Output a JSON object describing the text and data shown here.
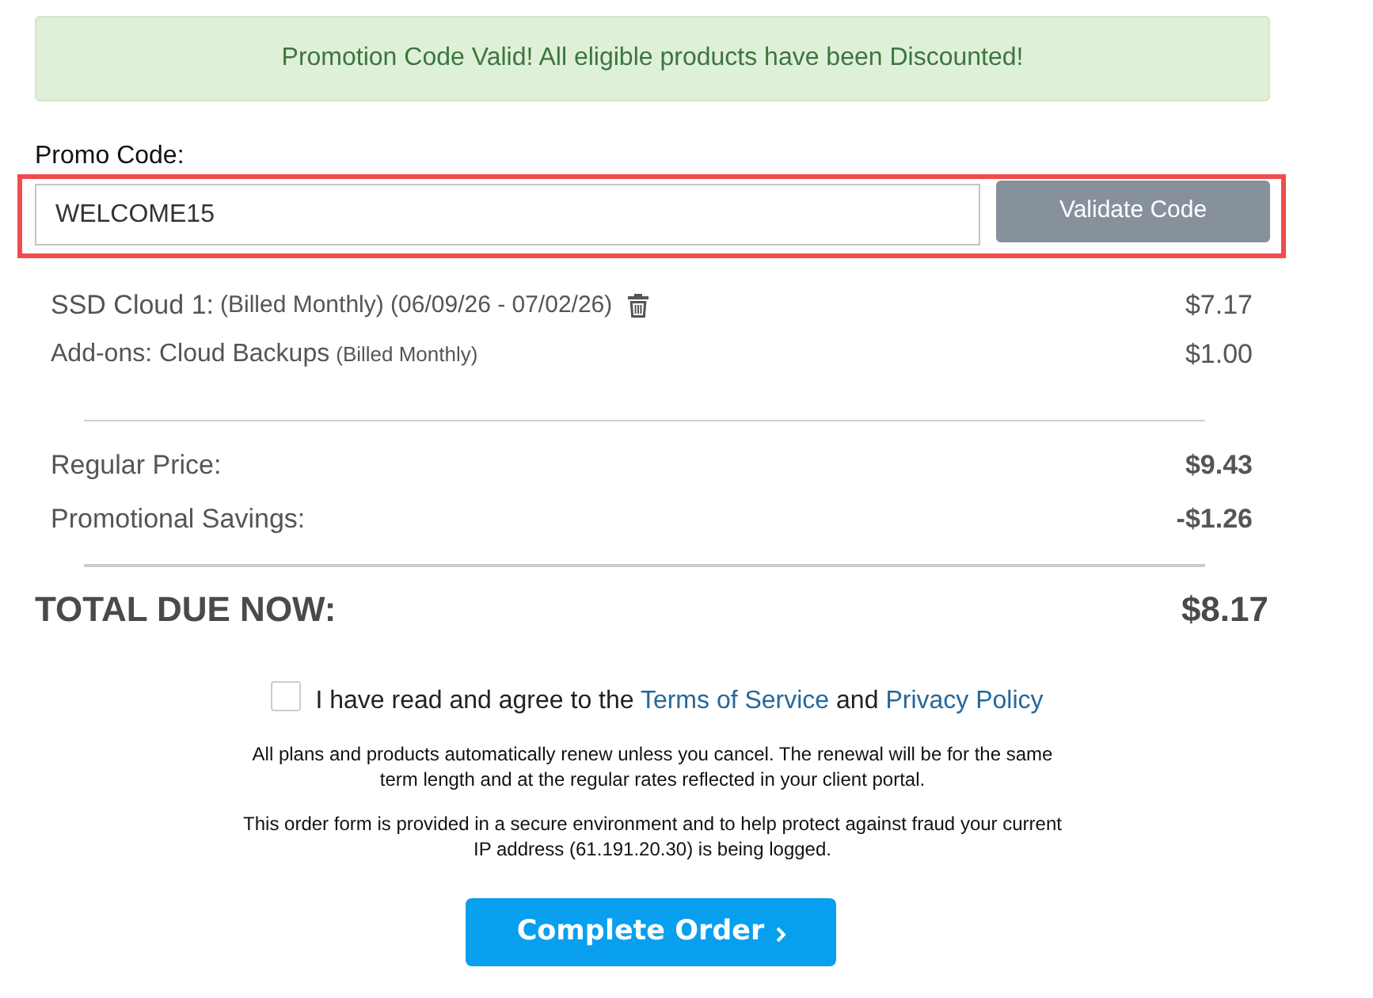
{
  "alert": {
    "message": "Promotion Code Valid! All eligible products have been Discounted!"
  },
  "promo": {
    "label": "Promo Code:",
    "value": "WELCOME15",
    "button": "Validate Code",
    "highlighted": true
  },
  "line_items": [
    {
      "name": "SSD Cloud 1:",
      "details": "(Billed Monthly) (06/09/26 - 07/02/26)",
      "removable": true,
      "price": "$7.17",
      "kind": "product"
    },
    {
      "name": "Add-ons: Cloud Backups",
      "details": "(Billed Monthly)",
      "removable": false,
      "price": "$1.00",
      "kind": "addon"
    }
  ],
  "summary": [
    {
      "label": "Regular Price:",
      "value": "$9.43"
    },
    {
      "label": "Promotional Savings:",
      "value": "-$1.26"
    }
  ],
  "total": {
    "label": "TOTAL DUE NOW:",
    "value": "$8.17"
  },
  "agreement": {
    "checked": false,
    "parts": [
      {
        "kind": "text",
        "text": "I have read and agree to the"
      },
      {
        "kind": "link",
        "text": "Terms of Service"
      },
      {
        "kind": "text",
        "text": "and"
      },
      {
        "kind": "link",
        "text": "Privacy Policy"
      }
    ]
  },
  "notices": [
    "All plans and products automatically renew unless you cancel. The renewal will be for the same term length and at the regular rates reflected in your client portal.",
    "This order form is provided in a secure environment and to help protect against fraud your current IP address (61.191.20.30) is being logged."
  ],
  "submit": {
    "label": "Complete Order"
  }
}
